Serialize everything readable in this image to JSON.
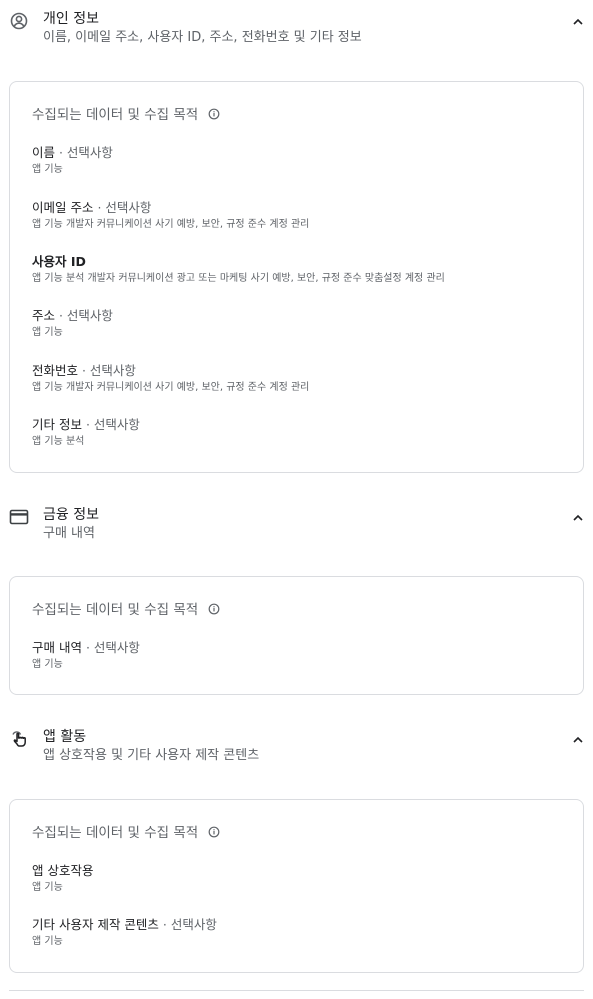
{
  "colors": {
    "text": "#202124",
    "secondary": "#5f6368",
    "border": "#dadce0"
  },
  "sections": [
    {
      "title": "개인 정보",
      "subtitle": "이름, 이메일 주소, 사용자 ID, 주소, 전화번호 및 기타 정보",
      "icon": "account-circle-icon",
      "card_heading": "수집되는 데이터 및 수집 목적",
      "items": [
        {
          "name": "이름",
          "optional": " · 선택사항",
          "purposes": "앱 기능"
        },
        {
          "name": "이메일 주소",
          "optional": " · 선택사항",
          "purposes": "앱 기능 개발자 커뮤니케이션 사기 예방, 보안, 규정 준수 계정 관리"
        },
        {
          "name": "사용자 ID",
          "optional": "",
          "purposes": "앱 기능 분석 개발자 커뮤니케이션 광고 또는 마케팅 사기 예방, 보안, 규정 준수 맞춤설정 계정 관리"
        },
        {
          "name": "주소",
          "optional": " · 선택사항",
          "purposes": "앱 기능"
        },
        {
          "name": "전화번호",
          "optional": " · 선택사항",
          "purposes": "앱 기능 개발자 커뮤니케이션 사기 예방, 보안, 규정 준수 계정 관리"
        },
        {
          "name": "기타 정보",
          "optional": " · 선택사항",
          "purposes": "앱 기능 분석"
        }
      ]
    },
    {
      "title": "금융 정보",
      "subtitle": "구매 내역",
      "icon": "credit-card-icon",
      "card_heading": "수집되는 데이터 및 수집 목적",
      "items": [
        {
          "name": "구매 내역",
          "optional": " · 선택사항",
          "purposes": "앱 기능"
        }
      ]
    },
    {
      "title": "앱 활동",
      "subtitle": "앱 상호작용 및 기타 사용자 제작 콘텐츠",
      "icon": "touch-app-icon",
      "card_heading": "수집되는 데이터 및 수집 목적",
      "items": [
        {
          "name": "앱 상호작용",
          "optional": "",
          "purposes": "앱 기능"
        },
        {
          "name": "기타 사용자 제작 콘텐츠",
          "optional": " · 선택사항",
          "purposes": "앱 기능"
        }
      ]
    }
  ]
}
